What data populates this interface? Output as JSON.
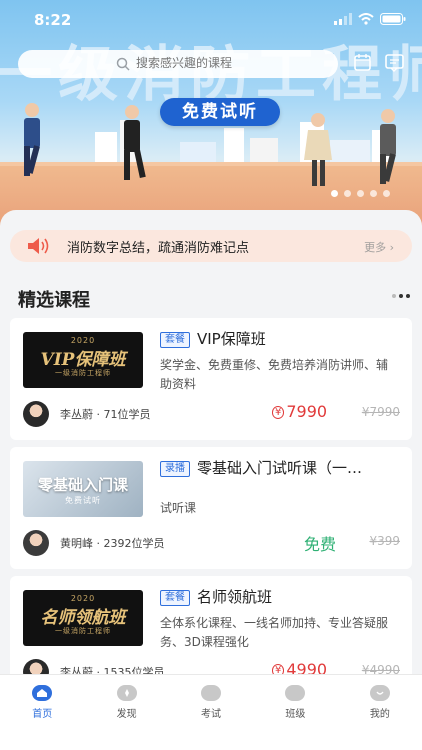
{
  "status_bar": {
    "time": "8:22"
  },
  "banner": {
    "headline": "一级消防工程师",
    "tag": "免费试听",
    "slide_count": 5,
    "active_slide": 0
  },
  "search": {
    "placeholder": "搜索感兴趣的课程"
  },
  "notice": {
    "text": "消防数字总结，疏通消防难记点",
    "more": "更多 ›"
  },
  "section": {
    "title": "精选课程"
  },
  "courses": [
    {
      "thumb_year": "2020",
      "thumb_title": "VIP保障班",
      "thumb_sub": "一级消防工程师",
      "tag": "套餐",
      "title": "VIP保障班",
      "desc": "奖学金、免费重修、免费培养消防讲师、辅助资料",
      "teacher": "李丛蔚 · 71位学员",
      "price": "7990",
      "original_price": "7990"
    },
    {
      "thumb_title": "零基础入门课",
      "thumb_sub": "免费试听",
      "tag": "录播",
      "title": "零基础入门试听课（一…",
      "desc": "试听课",
      "teacher": "黄明峰 · 2392位学员",
      "price": "免费",
      "original_price": "399"
    },
    {
      "thumb_year": "2020",
      "thumb_title": "名师领航班",
      "thumb_sub": "一级消防工程师",
      "tag": "套餐",
      "title": "名师领航班",
      "desc": "全体系化课程、一线名师加持、专业答疑服务、3D课程强化",
      "teacher": "李丛蔚 · 1535位学员",
      "price": "4990",
      "original_price": "4990"
    }
  ],
  "tabs": [
    {
      "label": "首页",
      "icon": "home-icon",
      "active": true
    },
    {
      "label": "发现",
      "icon": "compass-icon",
      "active": false
    },
    {
      "label": "考试",
      "icon": "exam-icon",
      "active": false
    },
    {
      "label": "班级",
      "icon": "class-icon",
      "active": false
    },
    {
      "label": "我的",
      "icon": "profile-icon",
      "active": false
    }
  ],
  "colors": {
    "accent": "#2f6fdc",
    "price_red": "#e13a3a",
    "free_green": "#2fb074",
    "notice_bg": "#fbe7de"
  }
}
